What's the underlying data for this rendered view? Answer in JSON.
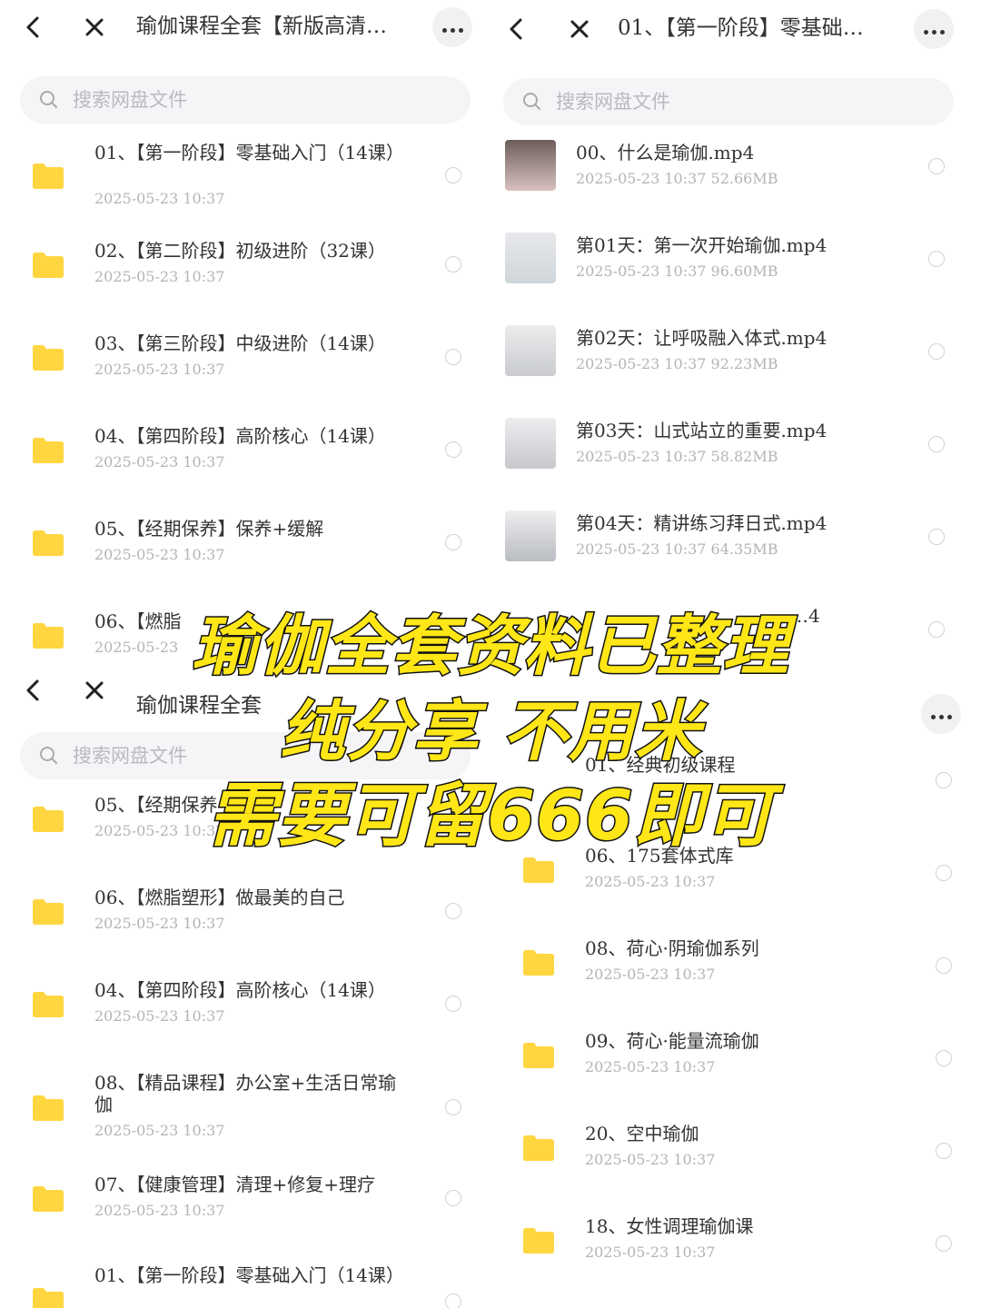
{
  "panels": {
    "tl": {
      "title": "瑜伽课程全套【新版高清…",
      "search_placeholder": "搜索网盘文件",
      "items": [
        {
          "name": "01、【第一阶段】零基础入门（14课）",
          "meta": "2025-05-23  10:37"
        },
        {
          "name": "02、【第二阶段】初级进阶（32课）",
          "meta": "2025-05-23  10:37"
        },
        {
          "name": "03、【第三阶段】中级进阶（14课）",
          "meta": "2025-05-23  10:37"
        },
        {
          "name": "04、【第四阶段】高阶核心（14课）",
          "meta": "2025-05-23  10:37"
        },
        {
          "name": "05、【经期保养】保养+缓解",
          "meta": "2025-05-23  10:37"
        },
        {
          "name": "06、【燃脂",
          "meta": "2025-05-23"
        }
      ]
    },
    "tr": {
      "title": "01、【第一阶段】零基础…",
      "search_placeholder": "搜索网盘文件",
      "items": [
        {
          "name": "00、什么是瑜伽.mp4",
          "meta": "2025-05-23  10:37  52.66MB"
        },
        {
          "name": "第01天：第一次开始瑜伽.mp4",
          "meta": "2025-05-23  10:37  96.60MB"
        },
        {
          "name": "第02天：让呼吸融入体式.mp4",
          "meta": "2025-05-23  10:37  92.23MB"
        },
        {
          "name": "第03天：山式站立的重要.mp4",
          "meta": "2025-05-23  10:37  58.82MB"
        },
        {
          "name": "第04天：精讲练习拜日式.mp4",
          "meta": "2025-05-23  10:37  64.35MB"
        },
        {
          "name": "…4",
          "meta": ""
        }
      ]
    },
    "bl": {
      "title": "瑜伽课程全套",
      "search_placeholder": "搜索网盘文件",
      "items": [
        {
          "name": "05、【经期保养",
          "meta": "2025-05-23  10:37"
        },
        {
          "name": "06、【燃脂塑形】做最美的自己",
          "meta": "2025-05-23  10:37"
        },
        {
          "name": "04、【第四阶段】高阶核心（14课）",
          "meta": "2025-05-23  10:37"
        },
        {
          "name": "08、【精品课程】办公室+生活日常瑜伽",
          "meta": "2025-05-23  10:37"
        },
        {
          "name": "07、【健康管理】清理+修复+理疗",
          "meta": "2025-05-23  10:37"
        },
        {
          "name": "01、【第一阶段】零基础入门（14课）",
          "meta": ""
        }
      ]
    },
    "br": {
      "partial_first": "01、经典初级课程",
      "items": [
        {
          "name": "06、175套体式库",
          "meta": "2025-05-23  10:37"
        },
        {
          "name": "08、荷心·阴瑜伽系列",
          "meta": "2025-05-23  10:37"
        },
        {
          "name": "09、荷心·能量流瑜伽",
          "meta": "2025-05-23  10:37"
        },
        {
          "name": "20、空中瑜伽",
          "meta": "2025-05-23  10:37"
        },
        {
          "name": "18、女性调理瑜伽课",
          "meta": "2025-05-23  10:37"
        }
      ]
    }
  },
  "overlay": {
    "line1": "瑜伽全套资料已整理",
    "line2": "纯分享 不用米",
    "line3": "需要可留666即可"
  },
  "colors": {
    "folder": "#ffd640",
    "overlay_fill": "#ffe617",
    "overlay_stroke": "#111111",
    "meta_text": "#b4b4b4"
  },
  "icons": [
    "back-arrow-icon",
    "close-icon",
    "more-icon",
    "search-icon",
    "folder-icon",
    "radio-icon"
  ]
}
